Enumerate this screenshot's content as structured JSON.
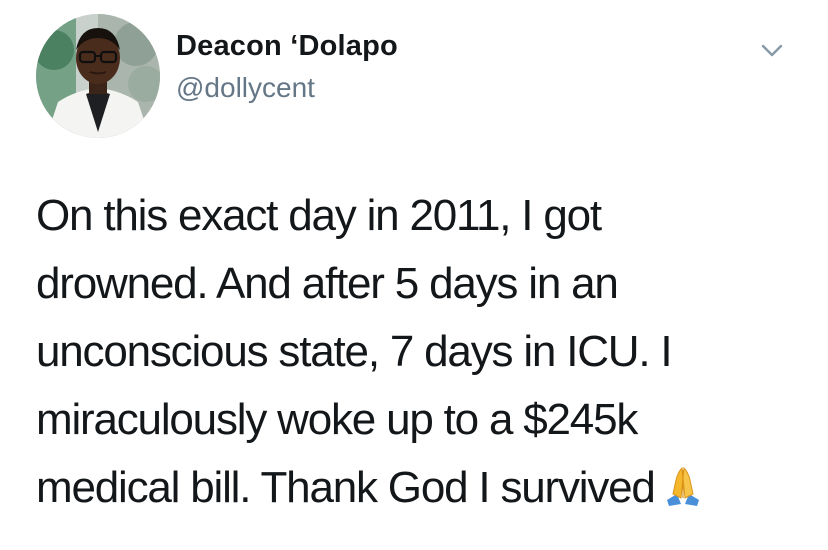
{
  "author": {
    "name": "Deacon ‘Dolapo",
    "handle": "@dollycent"
  },
  "tweet": {
    "lines": [
      "On this exact day in 2011, I got",
      "drowned. And after 5 days in an",
      "unconscious state, 7 days in ICU. I",
      "miraculously woke up to a $245k",
      "medical bill. Thank God I survived"
    ],
    "trailing_emoji": "folded-hands-icon"
  },
  "icons": {
    "menu": "chevron-down-icon",
    "avatar": "avatar"
  },
  "colors": {
    "text": "#14171a",
    "handle": "#657786",
    "caret": "#8899a6",
    "emoji": "#f5b72b"
  }
}
